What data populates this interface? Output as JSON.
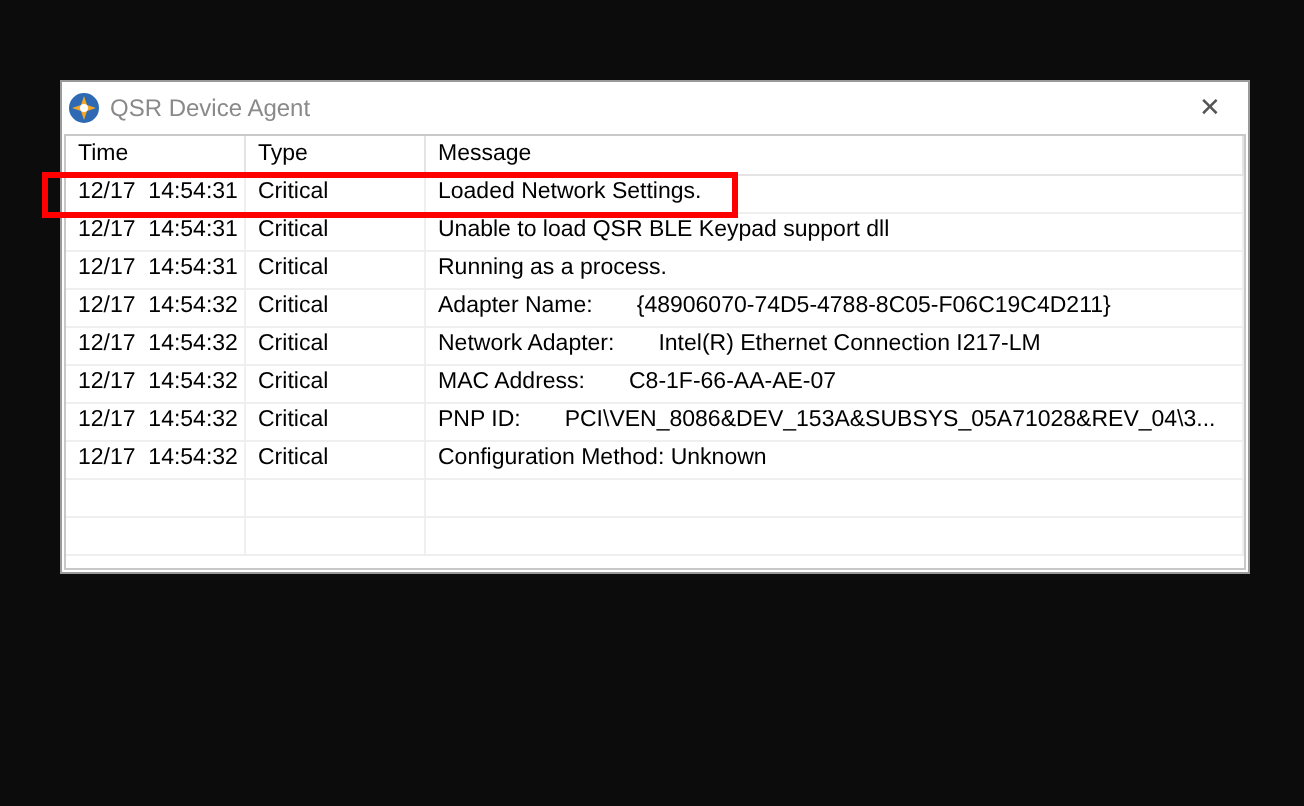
{
  "window": {
    "title": "QSR Device Agent",
    "close": "✕"
  },
  "table": {
    "columns": [
      "Time",
      "Type",
      "Message"
    ],
    "rows": [
      {
        "time": "12/17  14:54:31",
        "type": "Critical",
        "message": "Loaded Network Settings.",
        "highlighted": true
      },
      {
        "time": "12/17  14:54:31",
        "type": "Critical",
        "message": "Unable to load QSR BLE Keypad support dll",
        "highlighted": false
      },
      {
        "time": "12/17  14:54:31",
        "type": "Critical",
        "message": "Running as a process.",
        "highlighted": false
      },
      {
        "time": "12/17  14:54:32",
        "type": "Critical",
        "message": "Adapter Name:",
        "value": "{48906070-74D5-4788-8C05-F06C19C4D211}",
        "highlighted": false
      },
      {
        "time": "12/17  14:54:32",
        "type": "Critical",
        "message": "Network Adapter:",
        "value": "Intel(R) Ethernet Connection I217-LM",
        "highlighted": false
      },
      {
        "time": "12/17  14:54:32",
        "type": "Critical",
        "message": "MAC Address:",
        "value": "C8-1F-66-AA-AE-07",
        "highlighted": false
      },
      {
        "time": "12/17  14:54:32",
        "type": "Critical",
        "message": "PNP ID:",
        "value": "PCI\\VEN_8086&DEV_153A&SUBSYS_05A71028&REV_04\\3...",
        "highlighted": false
      },
      {
        "time": "12/17  14:54:32",
        "type": "Critical",
        "message": "Configuration Method: Unknown",
        "highlighted": false
      }
    ]
  }
}
